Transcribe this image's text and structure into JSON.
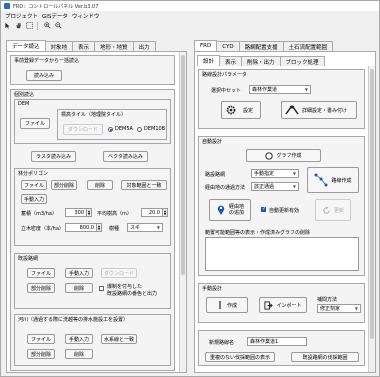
{
  "window": {
    "title": "FRD：コントロールパネル Ver.b3.07"
  },
  "menu": [
    "プロジェクト",
    "GISデータ",
    "ウィンドウ"
  ],
  "left_tabs": [
    "データ読込",
    "対象地",
    "表示",
    "地形・地質",
    "出力"
  ],
  "left": {
    "prior": {
      "title": "事前登録データからー括読込",
      "load_btn": "読み込み"
    },
    "individual": {
      "title": "個別読込"
    },
    "dem": {
      "title": "DEM",
      "file_btn": "ファイル",
      "std_tile": "標高タイル（地理院タイル）",
      "download_btn": "ダウンロード",
      "dem5a": "DEM5A",
      "dem10b": "DEM10B"
    },
    "raster_btn": "ラスタ読み込み",
    "vector_btn": "ベクタ読み込み",
    "polygon": {
      "title": "林分ポリゴン",
      "file_btn": "ファイル",
      "partial_delete_btn": "部分削除",
      "delete_btn": "削除",
      "target_btn": "対象範囲と一致",
      "manual_btn": "手動入力",
      "volume_label": "蓄積（m3/ha）",
      "volume_value": "300",
      "avg_height_label": "平均樹高（m）",
      "avg_height_value": "20.0",
      "density_label": "立木密度（本/ha）",
      "density_value": "800.0",
      "species_label": "樹種",
      "species_value": "スギ"
    },
    "existing_road": {
      "title": "既設路網",
      "file_btn": "ファイル",
      "manual_btn": "手動入力",
      "download_btn": "ダウンロード",
      "partial_delete_btn": "部分削除",
      "delete_btn": "削除",
      "note_line1": "爆制を付与した",
      "note_line2": "既設路網の番色と出力"
    },
    "river": {
      "title": "河川（通過する際に洗越等の排水施設工を設置）",
      "file_btn": "ファイル",
      "manual_btn": "手動入力",
      "water_btn": "水系線と一致",
      "partial_delete_btn": "部分削除",
      "delete_btn": "削除"
    }
  },
  "right_tabs_top": [
    "FRD",
    "CYD",
    "路網配置支援",
    "土石流配置範囲"
  ],
  "right_tabs_sub": [
    "設計",
    "表示",
    "削除・出力",
    "ブロック処理"
  ],
  "right": {
    "road_params": {
      "title": "路線設計パラメータ",
      "preset_label": "選択中セット",
      "preset_value": "森林作業道",
      "settings_btn": "設定",
      "detail_btn": "詳細設定・書み付け"
    },
    "auto_design": {
      "title": "自動設計",
      "graph_btn": "グラフ作成",
      "road_method_label": "路設路網",
      "road_method_value": "手動指定",
      "endpoint_label": "経由地の通過方法",
      "endpoint_value": "該正通過",
      "road_make_btn": "路線作成",
      "waypoint_btn_line1": "経由地",
      "waypoint_btn_line2": "の追加",
      "auto_update_label": "自動更新有効",
      "update_btn": "更新",
      "hint": "範置可能範囲等の表示・作成済みグラフの削除"
    },
    "manual_design": {
      "title": "手動設計",
      "create_btn": "作成",
      "import_btn": "インポート",
      "method_label": "補間方法",
      "method_value": "修正刻家"
    },
    "new_route": {
      "label": "新規路線名",
      "value": "森林作業道1",
      "show_overlap_btn": "重複のない伐採範囲の表示",
      "show_existing_btn": "既設路網の伐採範囲"
    }
  },
  "colors": {
    "accent": "#1a5bb0",
    "border": "#a8a8a8"
  }
}
